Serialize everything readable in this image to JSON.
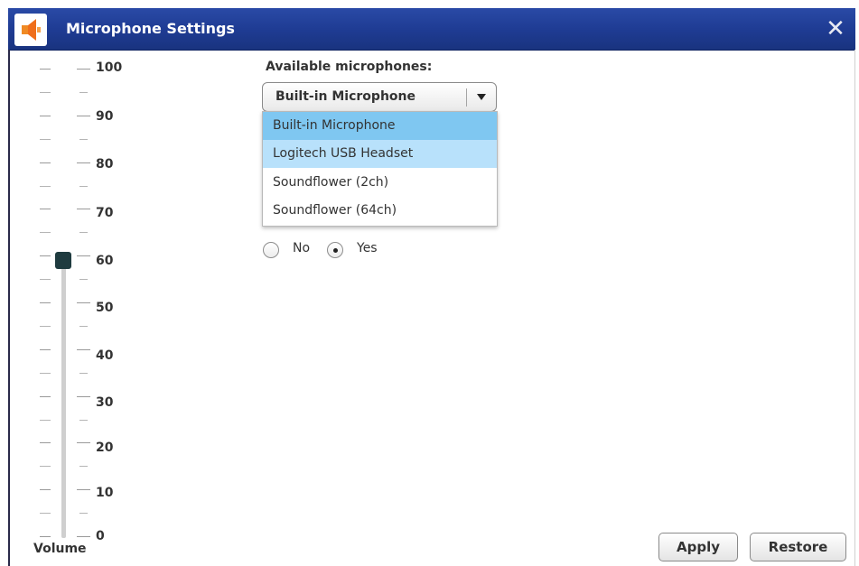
{
  "window": {
    "title": "Microphone Settings",
    "close_glyph": "✕",
    "title_icon": "speaker-icon",
    "accent_color": "#1f3c94"
  },
  "volume": {
    "label": "Volume",
    "value": 60,
    "min": 0,
    "max": 100,
    "scale_labels": [
      "100",
      "90",
      "80",
      "70",
      "60",
      "50",
      "40",
      "30",
      "20",
      "10",
      "0"
    ]
  },
  "microphones": {
    "label": "Available microphones:",
    "selected": "Built-in Microphone",
    "options": [
      "Built-in Microphone",
      "Logitech USB Headset",
      "Soundflower (2ch)",
      "Soundflower (64ch)"
    ],
    "highlight_selected_color": "#7fc7f1",
    "highlight_hover_color": "#b8e1fb"
  },
  "toggle": {
    "options": [
      "No",
      "Yes"
    ],
    "selected": "Yes"
  },
  "buttons": {
    "apply": "Apply",
    "restore": "Restore"
  }
}
